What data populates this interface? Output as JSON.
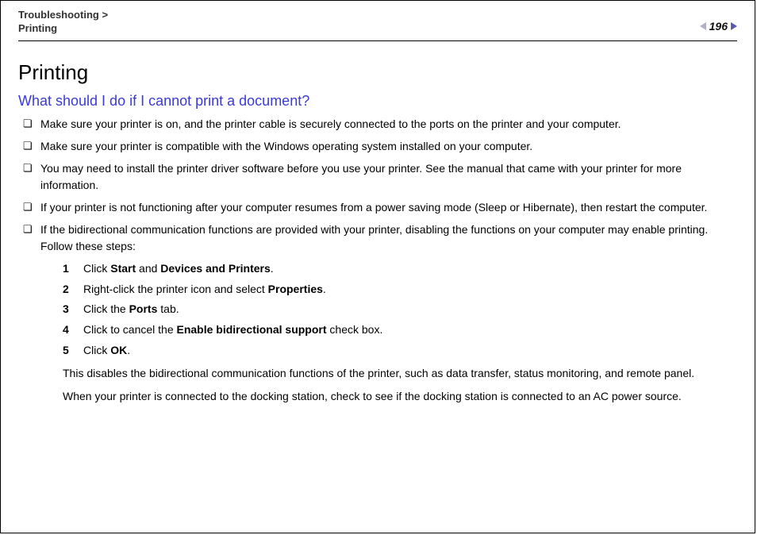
{
  "breadcrumb": {
    "top": "Troubleshooting",
    "separator": ">",
    "sub": "Printing"
  },
  "page_number": "196",
  "section_title": "Printing",
  "question": "What should I do if I cannot print a document?",
  "bullets": [
    "Make sure your printer is on, and the printer cable is securely connected to the ports on the printer and your computer.",
    "Make sure your printer is compatible with the Windows operating system installed on your computer.",
    "You may need to install the printer driver software before you use your printer. See the manual that came with your printer for more information.",
    "If your printer is not functioning after your computer resumes from a power saving mode (Sleep or Hibernate), then restart the computer.",
    "If the bidirectional communication functions are provided with your printer, disabling the functions on your computer may enable printing. Follow these steps:"
  ],
  "steps": [
    {
      "n": "1",
      "segments": [
        {
          "t": "Click "
        },
        {
          "t": "Start",
          "b": true
        },
        {
          "t": " and "
        },
        {
          "t": "Devices and Printers",
          "b": true
        },
        {
          "t": "."
        }
      ]
    },
    {
      "n": "2",
      "segments": [
        {
          "t": "Right-click the printer icon and select "
        },
        {
          "t": "Properties",
          "b": true
        },
        {
          "t": "."
        }
      ]
    },
    {
      "n": "3",
      "segments": [
        {
          "t": "Click the "
        },
        {
          "t": "Ports",
          "b": true
        },
        {
          "t": " tab."
        }
      ]
    },
    {
      "n": "4",
      "segments": [
        {
          "t": "Click to cancel the "
        },
        {
          "t": "Enable bidirectional support",
          "b": true
        },
        {
          "t": " check box."
        }
      ]
    },
    {
      "n": "5",
      "segments": [
        {
          "t": "Click "
        },
        {
          "t": "OK",
          "b": true
        },
        {
          "t": "."
        }
      ]
    }
  ],
  "after_steps": [
    "This disables the bidirectional communication functions of the printer, such as data transfer, status monitoring, and remote panel.",
    "When your printer is connected to the docking station, check to see if the docking station is connected to an AC power source."
  ]
}
